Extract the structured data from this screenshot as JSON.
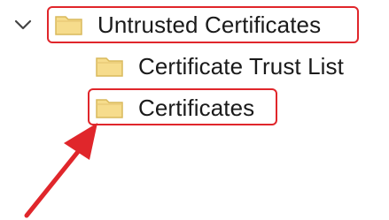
{
  "tree": {
    "items": [
      {
        "label": "Untrusted Certificates",
        "expanded": true,
        "icon": "folder-icon"
      },
      {
        "label": "Certificate Trust List",
        "icon": "folder-icon"
      },
      {
        "label": "Certificates",
        "icon": "folder-icon"
      }
    ]
  },
  "colors": {
    "annotation": "#e0262b",
    "folder_fill": "#f6dc8c",
    "folder_edge": "#d9b95b"
  }
}
